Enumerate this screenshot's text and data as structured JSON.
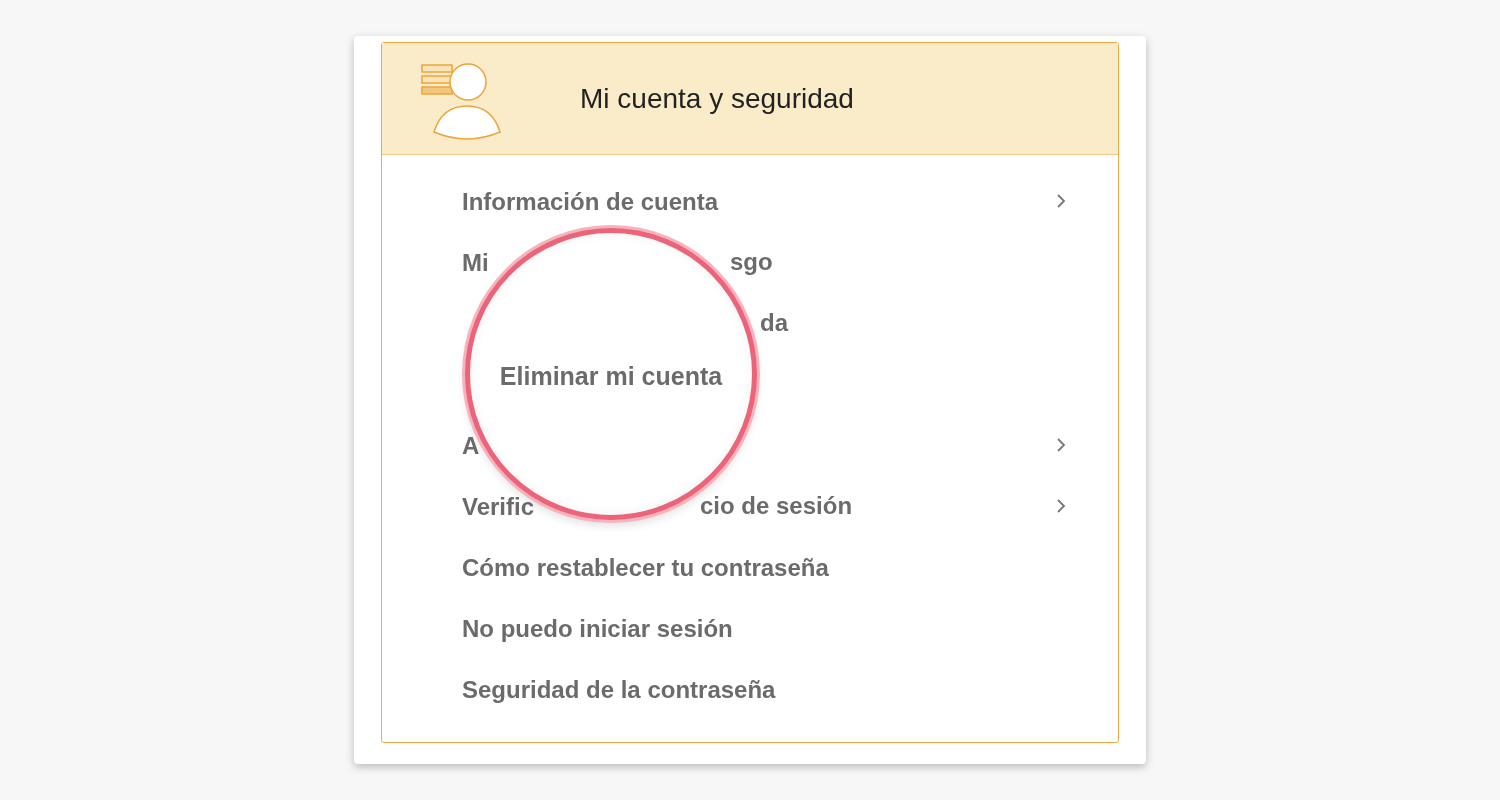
{
  "section": {
    "title": "Mi cuenta y seguridad"
  },
  "items": [
    {
      "kind": "full",
      "parts": [
        "Información de cuenta"
      ],
      "chevron": true
    },
    {
      "kind": "partial",
      "parts": [
        "Mi",
        "sgo"
      ],
      "chevron": false
    },
    {
      "kind": "partial",
      "parts": [
        "da"
      ],
      "chevron": false
    },
    {
      "kind": "magnified",
      "parts": [
        "Eliminar mi cuenta"
      ],
      "chevron": false
    },
    {
      "kind": "partial",
      "parts": [
        "A"
      ],
      "chevron": true
    },
    {
      "kind": "partial",
      "parts": [
        "Verific",
        "cio de sesión"
      ],
      "chevron": true
    },
    {
      "kind": "full",
      "parts": [
        "Cómo restablecer tu contraseña"
      ],
      "chevron": false
    },
    {
      "kind": "full",
      "parts": [
        "No puedo iniciar sesión"
      ],
      "chevron": false
    },
    {
      "kind": "full",
      "parts": [
        "Seguridad de la contraseña"
      ],
      "chevron": false
    }
  ]
}
